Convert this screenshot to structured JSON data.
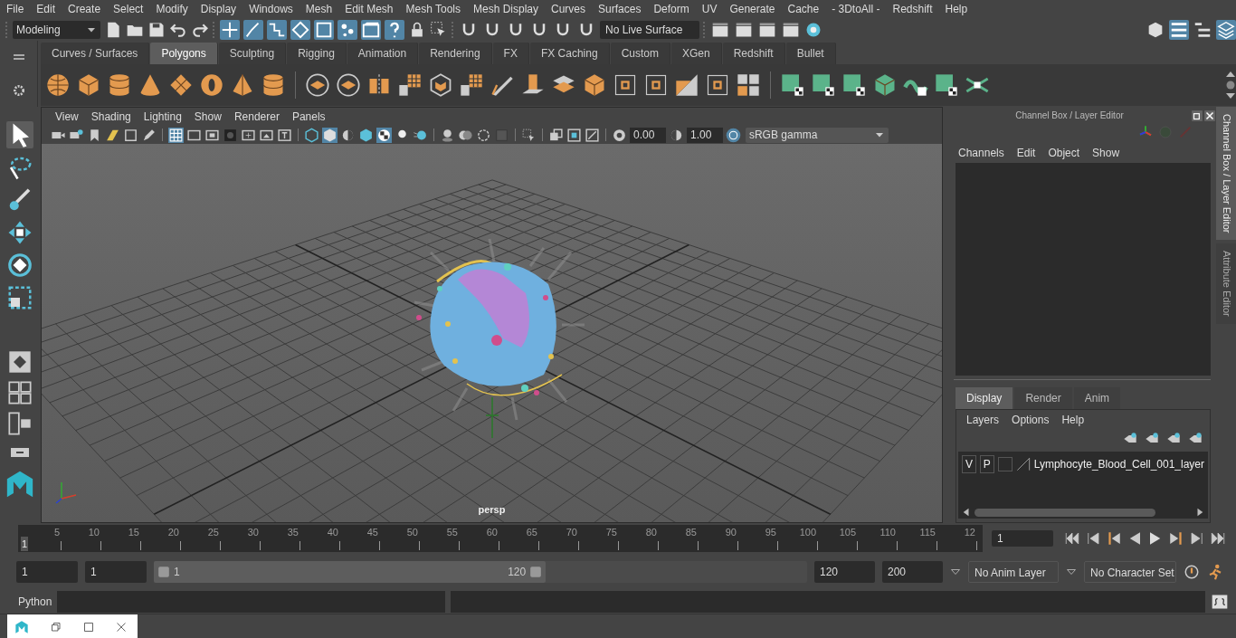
{
  "menu_bar": [
    "File",
    "Edit",
    "Create",
    "Select",
    "Modify",
    "Display",
    "Windows",
    "Mesh",
    "Edit Mesh",
    "Mesh Tools",
    "Mesh Display",
    "Curves",
    "Surfaces",
    "Deform",
    "UV",
    "Generate",
    "Cache",
    "- 3DtoAll -",
    "Redshift",
    "Help"
  ],
  "status_line": {
    "mode": "Modeling",
    "live_surface": "No Live Surface"
  },
  "shelf": {
    "tabs": [
      {
        "label": "Curves / Surfaces",
        "selected": false
      },
      {
        "label": "Polygons",
        "selected": true
      },
      {
        "label": "Sculpting",
        "selected": false
      },
      {
        "label": "Rigging",
        "selected": false
      },
      {
        "label": "Animation",
        "selected": false
      },
      {
        "label": "Rendering",
        "selected": false
      },
      {
        "label": "FX",
        "selected": false
      },
      {
        "label": "FX Caching",
        "selected": false
      },
      {
        "label": "Custom",
        "selected": false
      },
      {
        "label": "XGen",
        "selected": false
      },
      {
        "label": "Redshift",
        "selected": false
      },
      {
        "label": "Bullet",
        "selected": false
      }
    ]
  },
  "viewport": {
    "menu": [
      "View",
      "Shading",
      "Lighting",
      "Show",
      "Renderer",
      "Panels"
    ],
    "exposure": "0.00",
    "gamma": "1.00",
    "color_space": "sRGB gamma",
    "camera": "persp"
  },
  "channel_box": {
    "title": "Channel Box / Layer Editor",
    "menu": [
      "Channels",
      "Edit",
      "Object",
      "Show"
    ]
  },
  "layer_editor": {
    "tabs": [
      {
        "label": "Display",
        "selected": true
      },
      {
        "label": "Render",
        "selected": false
      },
      {
        "label": "Anim",
        "selected": false
      }
    ],
    "menu": [
      "Layers",
      "Options",
      "Help"
    ],
    "layers": [
      {
        "visibility": "V",
        "playback": "P",
        "name": "Lymphocyte_Blood_Cell_001_layer"
      }
    ]
  },
  "side_tabs": [
    {
      "label": "Channel Box / Layer Editor",
      "selected": true
    },
    {
      "label": "Attribute Editor",
      "selected": false
    }
  ],
  "time_slider": {
    "level": 0,
    "current_frame_marker": "1",
    "ticks": [
      "5",
      "10",
      "15",
      "20",
      "25",
      "30",
      "35",
      "40",
      "45",
      "50",
      "55",
      "60",
      "65",
      "70",
      "75",
      "80",
      "85",
      "90",
      "95",
      "100",
      "105",
      "110",
      "115",
      "12"
    ],
    "current_frame": "1"
  },
  "range_slider": {
    "level": 0.6,
    "start": "1",
    "playback_start": "1",
    "slider_start": "1",
    "slider_end": "120",
    "playback_end": "120",
    "end": "200",
    "anim_layer": "No Anim Layer",
    "character_set": "No Character Set"
  },
  "command_line": {
    "language": "Python"
  }
}
